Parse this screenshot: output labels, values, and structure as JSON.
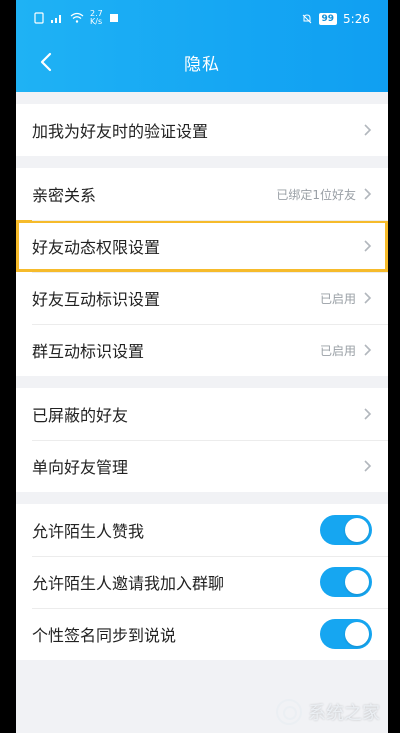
{
  "status_bar": {
    "network_speed_top": "2.7",
    "network_speed_bottom": "K/s",
    "battery": "99",
    "time": "5:26"
  },
  "header": {
    "title": "隐私",
    "back_icon": "chevron-left-icon"
  },
  "groups": [
    {
      "items": [
        {
          "label": "加我为好友时的验证设置",
          "value": ""
        }
      ]
    },
    {
      "items": [
        {
          "label": "亲密关系",
          "value": "已绑定1位好友"
        },
        {
          "label": "好友动态权限设置",
          "value": "",
          "highlighted": true
        },
        {
          "label": "好友互动标识设置",
          "value": "已启用"
        },
        {
          "label": "群互动标识设置",
          "value": "已启用"
        }
      ]
    },
    {
      "items": [
        {
          "label": "已屏蔽的好友",
          "value": ""
        },
        {
          "label": "单向好友管理",
          "value": ""
        }
      ]
    },
    {
      "items": [
        {
          "label": "允许陌生人赞我",
          "toggle": true
        },
        {
          "label": "允许陌生人邀请我加入群聊",
          "toggle": true
        },
        {
          "label": "个性签名同步到说说",
          "toggle": true
        }
      ]
    }
  ],
  "watermark": {
    "text": "系统之家"
  },
  "colors": {
    "accent": "#16a6f1",
    "highlight": "#f6bb2b"
  }
}
